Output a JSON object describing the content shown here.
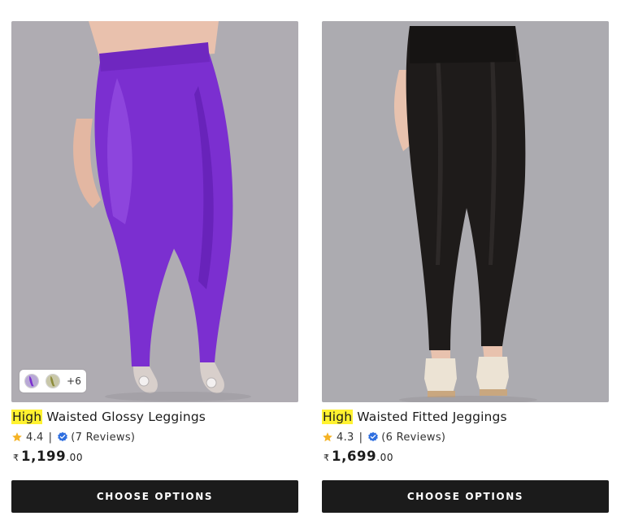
{
  "products": [
    {
      "title_highlight": "High",
      "title_rest": " Waisted Glossy Leggings",
      "rating": "4.4",
      "separator": "|",
      "reviews": "(7 Reviews)",
      "currency": "₹",
      "price_main": "1,199",
      "price_decimal": ".00",
      "button_label": "CHOOSE OPTIONS",
      "swatch_more": "+6",
      "colors": {
        "garment": "#7b2fd0",
        "garment_shade": "#5a1aa8",
        "backdrop": "#a9a6ad",
        "skin": "#e9c1ad"
      }
    },
    {
      "title_highlight": "High",
      "title_rest": " Waisted Fitted Jeggings",
      "rating": "4.3",
      "separator": "|",
      "reviews": "(6 Reviews)",
      "currency": "₹",
      "price_main": "1,699",
      "price_decimal": ".00",
      "button_label": "CHOOSE OPTIONS",
      "colors": {
        "garment": "#1e1b1a",
        "garment_shade": "#0f0d0c",
        "backdrop": "#a7a5ab",
        "skin": "#e8c2ae"
      }
    }
  ],
  "theme": {
    "highlight": "#fff230",
    "button_bg": "#1b1b1b",
    "star": "#f5b325",
    "verified": "#2f6fe0"
  },
  "icons": [
    "star-icon",
    "verified-badge-icon"
  ]
}
